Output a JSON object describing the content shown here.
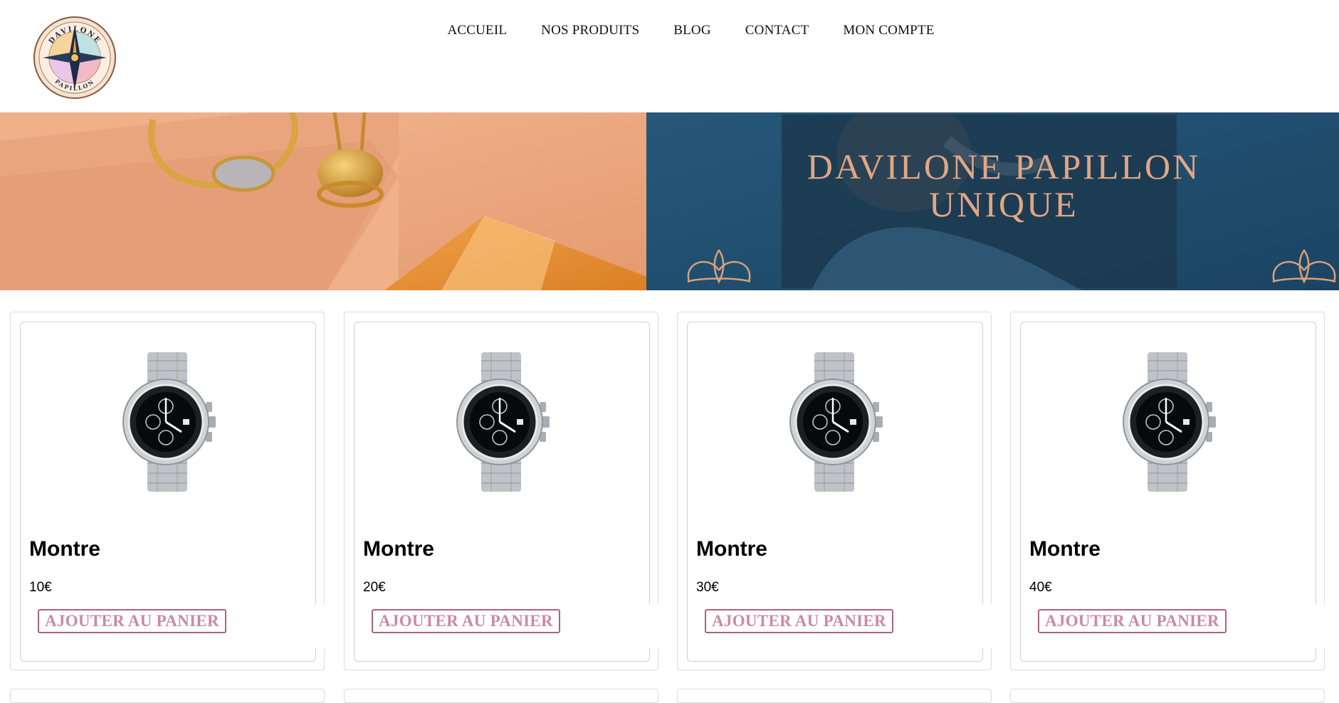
{
  "header": {
    "logo_text_top": "DAVILONE",
    "logo_text_bottom": "PAPILLON",
    "nav": [
      {
        "label": "ACCUEIL"
      },
      {
        "label": "NOS PRODUITS"
      },
      {
        "label": "BLOG"
      },
      {
        "label": "CONTACT"
      },
      {
        "label": "MON COMPTE"
      }
    ]
  },
  "banner": {
    "title_line1": "DAVILONE PAPILLON",
    "title_line2": "UNIQUE"
  },
  "products": [
    {
      "name": "Montre",
      "price": "10€",
      "button": "AJOUTER AU PANIER"
    },
    {
      "name": "Montre",
      "price": "20€",
      "button": "AJOUTER AU PANIER"
    },
    {
      "name": "Montre",
      "price": "30€",
      "button": "AJOUTER AU PANIER"
    },
    {
      "name": "Montre",
      "price": "40€",
      "button": "AJOUTER AU PANIER"
    }
  ],
  "colors": {
    "banner_left": "#eda880",
    "banner_right": "#1f4e6e",
    "banner_title": "#e2a684",
    "button_border": "#b0617e",
    "button_text": "#c98aa4"
  }
}
